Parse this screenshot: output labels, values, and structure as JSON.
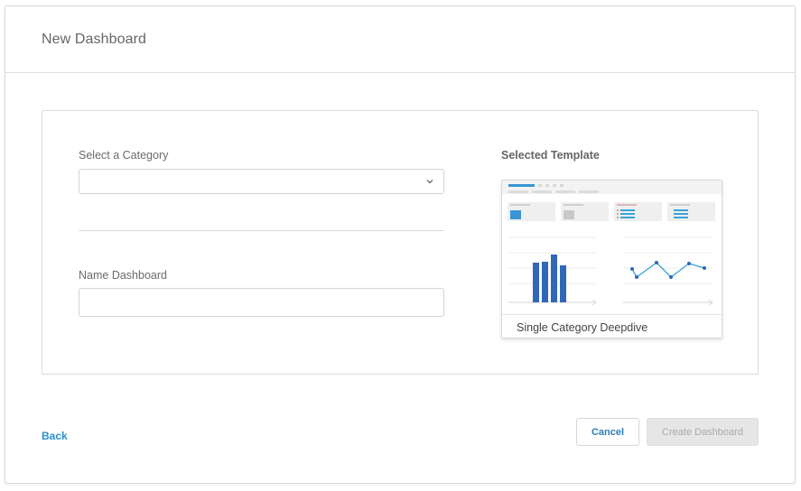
{
  "dialog": {
    "title": "New Dashboard"
  },
  "form": {
    "category_label": "Select a Category",
    "category_value": "",
    "name_label": "Name Dashboard",
    "name_value": "",
    "name_placeholder": ""
  },
  "template": {
    "heading": "Selected Template",
    "name": "Single Category Deepdive"
  },
  "footer": {
    "back_label": "Back",
    "cancel_label": "Cancel",
    "create_label": "Create Dashboard"
  },
  "icons": {
    "select_chevron": "chevron-down-icon"
  },
  "colors": {
    "accent": "#2b8fcf",
    "chart_bar": "#3067b8",
    "chart_line": "#3aa3d8",
    "disabled_bg": "#e6e6e6"
  }
}
